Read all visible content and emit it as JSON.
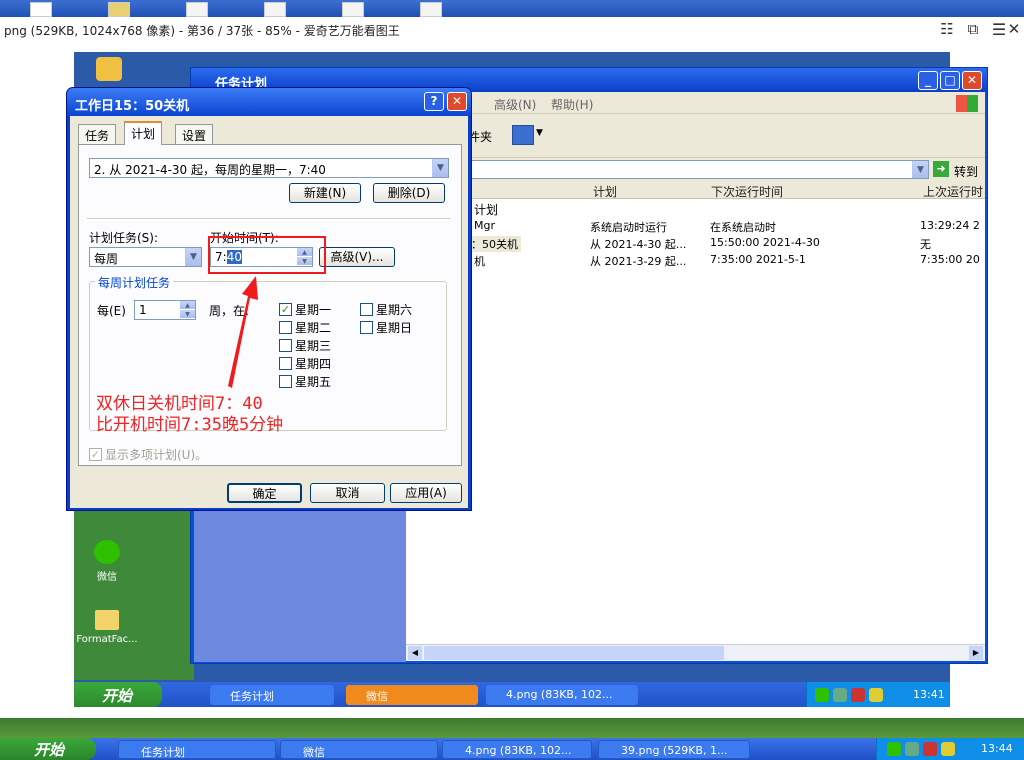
{
  "viewer": {
    "title": "png (529KB, 1024x768 像素) - 第36 / 37张 - 85% - 爱奇艺万能看图王",
    "controls": [
      "shirt-icon",
      "copy-icon",
      "menu-icon",
      "close-icon"
    ]
  },
  "desktop_icons": [
    {
      "label": "微信",
      "icon": "wechat-icon"
    },
    {
      "label": "FormatFac...",
      "icon": "folder-icon"
    }
  ],
  "explorer": {
    "title": "任务计划",
    "menu": [
      "高级(N)",
      "帮助(H)"
    ],
    "toolbar_folder_label": "件夹",
    "go_label": "转到",
    "columns": [
      "计划",
      "下次运行时间",
      "上次运行时"
    ],
    "rows": [
      {
        "name": "计划",
        "schedule": "",
        "next": "",
        "last": ""
      },
      {
        "name": "Mgr",
        "schedule": "系统启动时运行",
        "next": "在系统启动时",
        "last": "13:29:24  2"
      },
      {
        "name": "：50关机",
        "schedule": "从 2021-4-30 起...",
        "next": "15:50:00  2021-4-30",
        "last": "无"
      },
      {
        "name": "机",
        "schedule": "从 2021-3-29 起...",
        "next": "7:35:00  2021-5-1",
        "last": "7:35:00  20"
      }
    ]
  },
  "dialog": {
    "title": "工作日15：50关机",
    "tabs": [
      "任务",
      "计划",
      "设置"
    ],
    "active_tab": "计划",
    "schedule_combo": "2. 从 2021-4-30 起，每周的星期一，7:40",
    "new_button": "新建(N)",
    "delete_button": "删除(D)",
    "schedule_task_label": "计划任务(S):",
    "schedule_task_value": "每周",
    "start_time_label": "开始时间(T):",
    "start_time_hour": "7:",
    "start_time_minute": "40",
    "advanced_button": "高级(V)...",
    "weekly_group_label": "每周计划任务",
    "every_label": "每(E)",
    "every_value": "1",
    "week_on_label": "周，在:",
    "days": [
      {
        "label": "星期一",
        "checked": true
      },
      {
        "label": "星期二",
        "checked": false
      },
      {
        "label": "星期三",
        "checked": false
      },
      {
        "label": "星期四",
        "checked": false
      },
      {
        "label": "星期五",
        "checked": false
      },
      {
        "label": "星期六",
        "checked": false
      },
      {
        "label": "星期日",
        "checked": false
      }
    ],
    "show_multiple_label": "显示多项计划(U)。",
    "ok_button": "确定",
    "cancel_button": "取消",
    "apply_button": "应用(A)"
  },
  "annotation": {
    "line1": "双休日关机时间7：40",
    "line2": "比开机时间7:35晚5分钟",
    "color": "#f02424"
  },
  "inner_taskbar": {
    "start": "开始",
    "tasks": [
      "任务计划",
      "微信",
      "4.png (83KB, 102..."
    ],
    "clock": "13:41"
  },
  "outer_taskbar": {
    "start": "开始",
    "tasks": [
      "任务计划",
      "微信",
      "4.png (83KB, 102...",
      "39.png (529KB, 1..."
    ],
    "clock": "13:44"
  }
}
